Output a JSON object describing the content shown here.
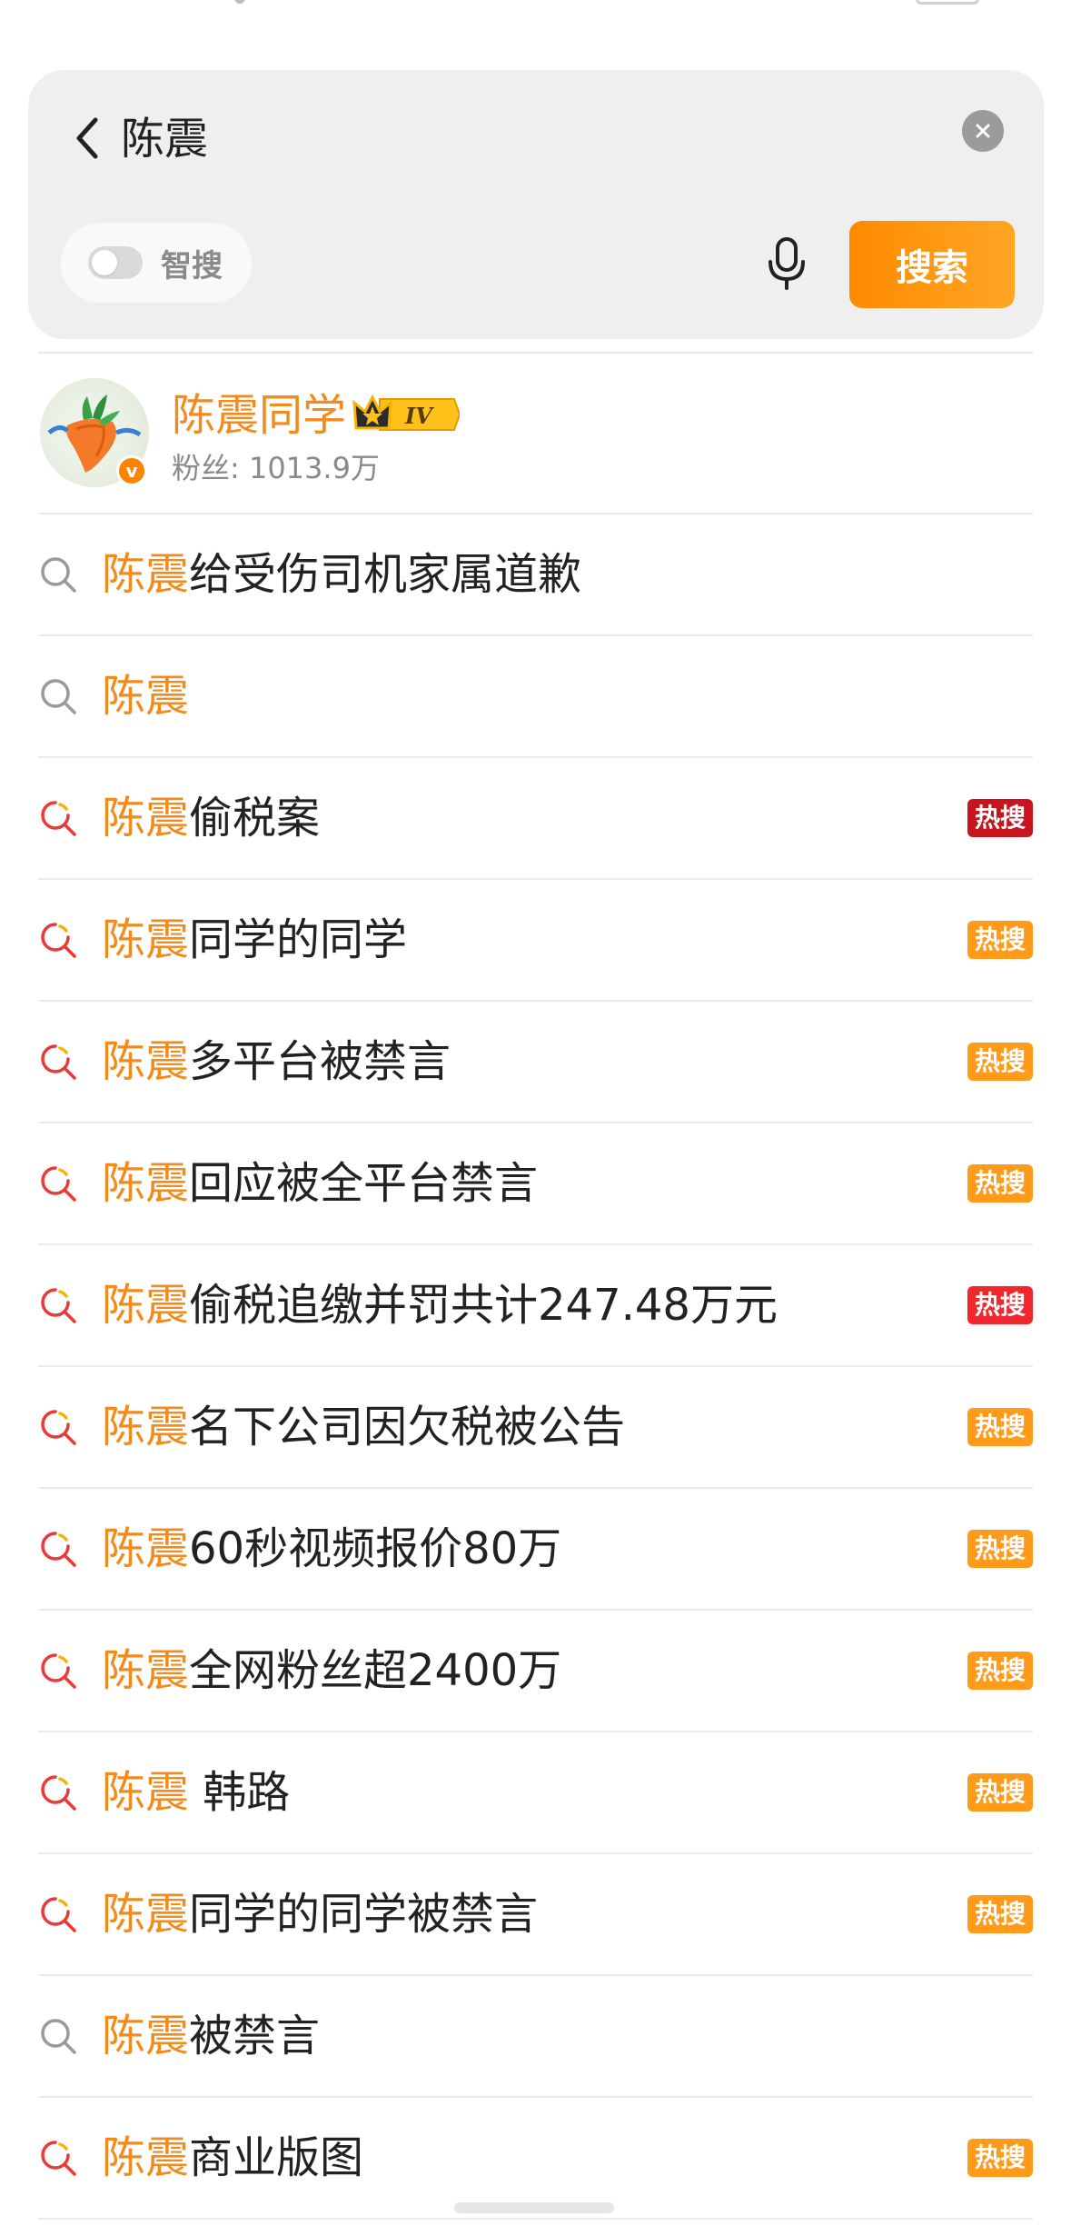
{
  "search": {
    "query": "陈震",
    "smart_toggle_label": "智搜",
    "smart_toggle_on": false,
    "search_button_label": "搜索",
    "accent_color": "#ff8c00"
  },
  "user_suggestion": {
    "name": "陈震同学",
    "badge_text": "IV",
    "fans": "粉丝: 1013.9万",
    "verified": true
  },
  "highlight_color": "#f28a1c",
  "suggestions": [
    {
      "hl": "陈震",
      "rest": "给受伤司机家属道歉",
      "icon": "search-icon",
      "badge": "",
      "badge_color": ""
    },
    {
      "hl": "陈震",
      "rest": "",
      "icon": "search-icon",
      "badge": "",
      "badge_color": ""
    },
    {
      "hl": "陈震",
      "rest": "偷税案",
      "icon": "hot-search-icon",
      "badge": "热搜",
      "badge_color": "#c8141e"
    },
    {
      "hl": "陈震",
      "rest": "同学的同学",
      "icon": "hot-search-icon",
      "badge": "热搜",
      "badge_color": "#ff9a1a"
    },
    {
      "hl": "陈震",
      "rest": "多平台被禁言",
      "icon": "hot-search-icon",
      "badge": "热搜",
      "badge_color": "#ff9a1a"
    },
    {
      "hl": "陈震",
      "rest": "回应被全平台禁言",
      "icon": "hot-search-icon",
      "badge": "热搜",
      "badge_color": "#ff9a1a"
    },
    {
      "hl": "陈震",
      "rest": "偷税追缴并罚共计247.48万元",
      "icon": "hot-search-icon",
      "badge": "热搜",
      "badge_color": "#f0282d"
    },
    {
      "hl": "陈震",
      "rest": "名下公司因欠税被公告",
      "icon": "hot-search-icon",
      "badge": "热搜",
      "badge_color": "#ff9a1a"
    },
    {
      "hl": "陈震",
      "rest": "60秒视频报价80万",
      "icon": "hot-search-icon",
      "badge": "热搜",
      "badge_color": "#ff9a1a"
    },
    {
      "hl": "陈震",
      "rest": "全网粉丝超2400万",
      "icon": "hot-search-icon",
      "badge": "热搜",
      "badge_color": "#ff9a1a"
    },
    {
      "hl": "陈震",
      "rest": " 韩路",
      "icon": "hot-search-icon",
      "badge": "热搜",
      "badge_color": "#ff9a1a"
    },
    {
      "hl": "陈震",
      "rest": "同学的同学被禁言",
      "icon": "hot-search-icon",
      "badge": "热搜",
      "badge_color": "#ff9a1a"
    },
    {
      "hl": "陈震",
      "rest": "被禁言",
      "icon": "search-icon",
      "badge": "",
      "badge_color": ""
    },
    {
      "hl": "陈震",
      "rest": "商业版图",
      "icon": "hot-search-icon",
      "badge": "热搜",
      "badge_color": "#ff9a1a"
    }
  ]
}
